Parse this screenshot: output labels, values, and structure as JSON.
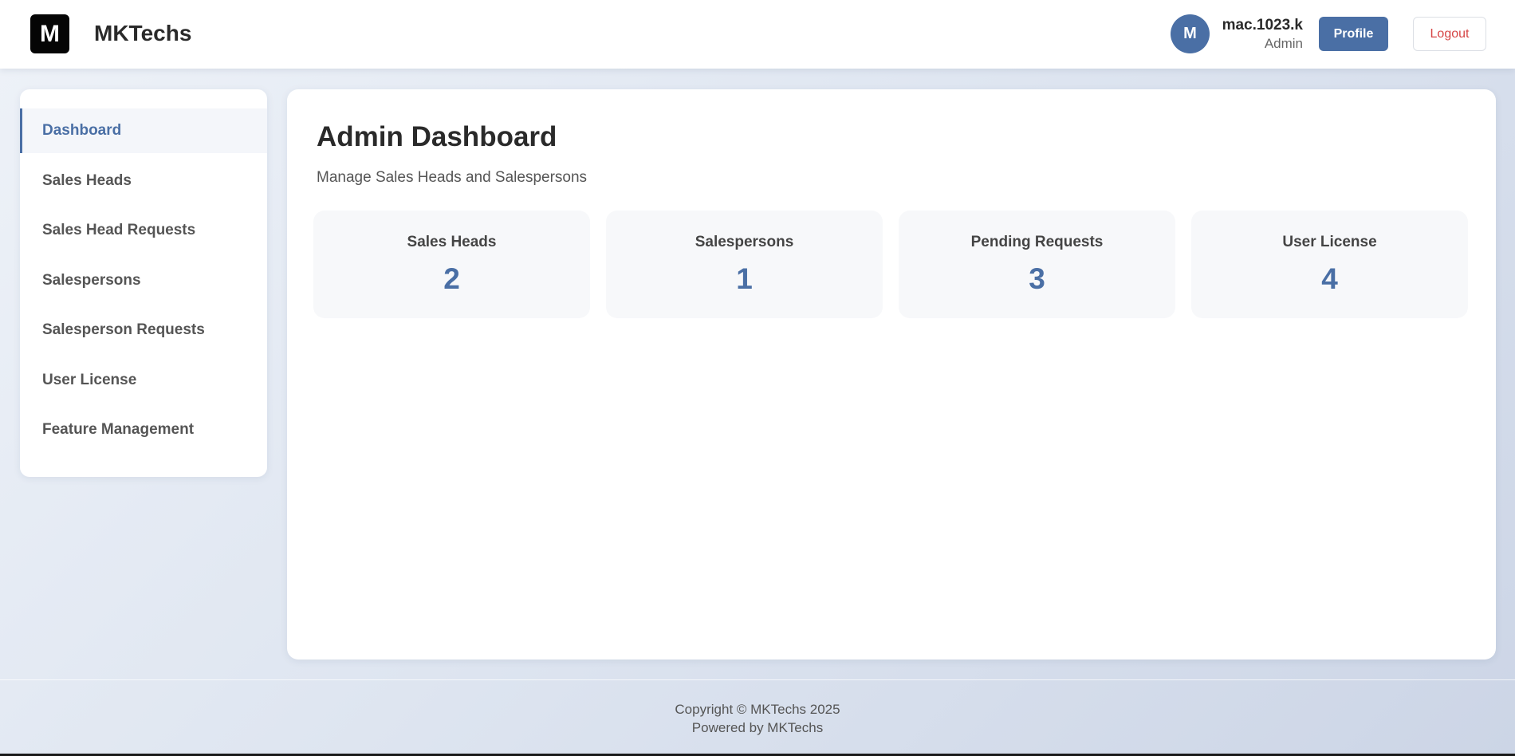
{
  "header": {
    "logo_letter": "M",
    "brand": "MKTechs",
    "user": {
      "avatar_initial": "M",
      "name": "mac.1023.k",
      "role": "Admin"
    },
    "profile_label": "Profile",
    "logout_label": "Logout"
  },
  "sidebar": {
    "items": [
      {
        "label": "Dashboard",
        "active": true
      },
      {
        "label": "Sales Heads",
        "active": false
      },
      {
        "label": "Sales Head Requests",
        "active": false
      },
      {
        "label": "Salespersons",
        "active": false
      },
      {
        "label": "Salesperson Requests",
        "active": false
      },
      {
        "label": "User License",
        "active": false
      },
      {
        "label": "Feature Management",
        "active": false
      }
    ]
  },
  "main": {
    "title": "Admin Dashboard",
    "subtitle": "Manage Sales Heads and Salespersons",
    "stats": [
      {
        "label": "Sales Heads",
        "value": "2"
      },
      {
        "label": "Salespersons",
        "value": "1"
      },
      {
        "label": "Pending Requests",
        "value": "3"
      },
      {
        "label": "User License",
        "value": "4"
      }
    ]
  },
  "footer": {
    "copyright": "Copyright © MKTechs 2025",
    "powered_by": "Powered by MKTechs"
  },
  "colors": {
    "accent": "#4a6fa5",
    "logout_text": "#d64545"
  }
}
